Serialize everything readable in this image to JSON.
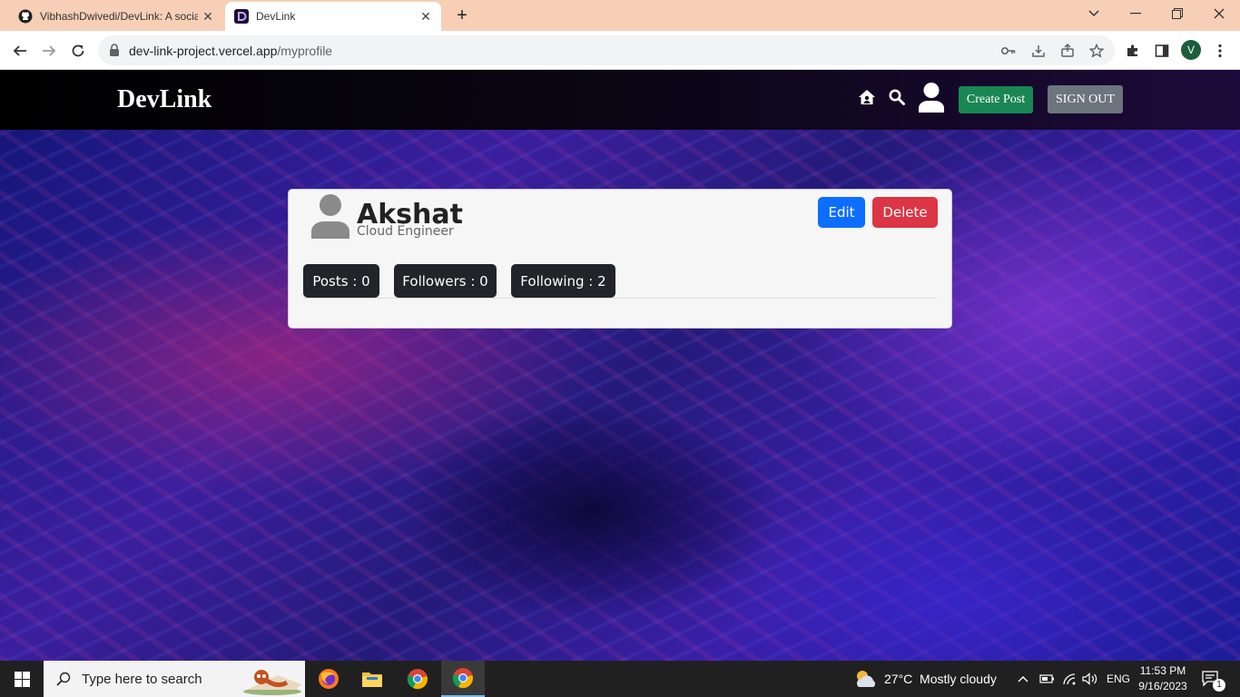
{
  "browser": {
    "tabs": [
      {
        "title": "VibhashDwivedi/DevLink: A social",
        "active": false,
        "icon": "github-icon"
      },
      {
        "title": "DevLink",
        "active": true,
        "icon": "devlink-favicon"
      }
    ],
    "url_host": "dev-link-project.vercel.app",
    "url_path": "/myprofile",
    "profile_initial": "V"
  },
  "navbar": {
    "brand": "DevLink",
    "create_post": "Create Post",
    "sign_out": "SIGN OUT"
  },
  "profile": {
    "name": "Akshat",
    "role": "Cloud Engineer",
    "edit": "Edit",
    "delete": "Delete",
    "stats": {
      "posts": "Posts : 0",
      "followers": "Followers : 0",
      "following": "Following : 2"
    }
  },
  "taskbar": {
    "search_placeholder": "Type here to search",
    "weather": "27°C  Mostly cloudy",
    "language": "ENG",
    "time": "11:53 PM",
    "date": "9/16/2023",
    "notification_count": "1"
  },
  "colors": {
    "create_post": "#198754",
    "sign_out": "#6c757d",
    "edit": "#0d6efd",
    "delete": "#dc3545",
    "stat_badge": "#212529"
  }
}
